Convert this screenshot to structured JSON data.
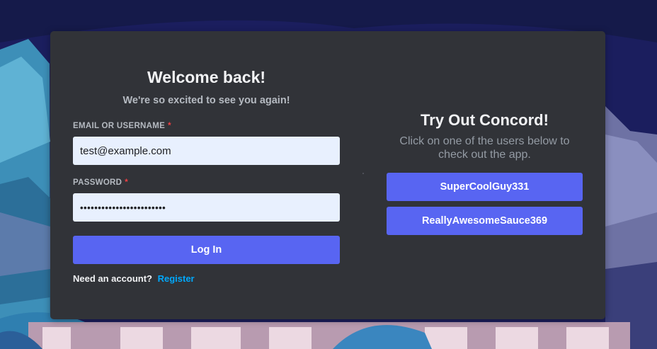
{
  "colors": {
    "card_bg": "#313338",
    "accent": "#5865f2",
    "link": "#00a8fc",
    "required": "#f23f43",
    "input_bg": "#e8f0fe"
  },
  "login": {
    "title": "Welcome back!",
    "subtitle": "We're so excited to see you again!",
    "email_label": "EMAIL OR USERNAME",
    "email_value": "test@example.com",
    "password_label": "PASSWORD",
    "password_value": "••••••••••••••••••••••••",
    "required_marker": "*",
    "login_button": "Log In",
    "need_account": "Need an account?",
    "register_link": "Register"
  },
  "try_out": {
    "title": "Try Out Concord!",
    "description": "Click on one of the users below to check out the app.",
    "users": [
      {
        "label": "SuperCoolGuy331"
      },
      {
        "label": "ReallyAwesomeSauce369"
      }
    ]
  }
}
